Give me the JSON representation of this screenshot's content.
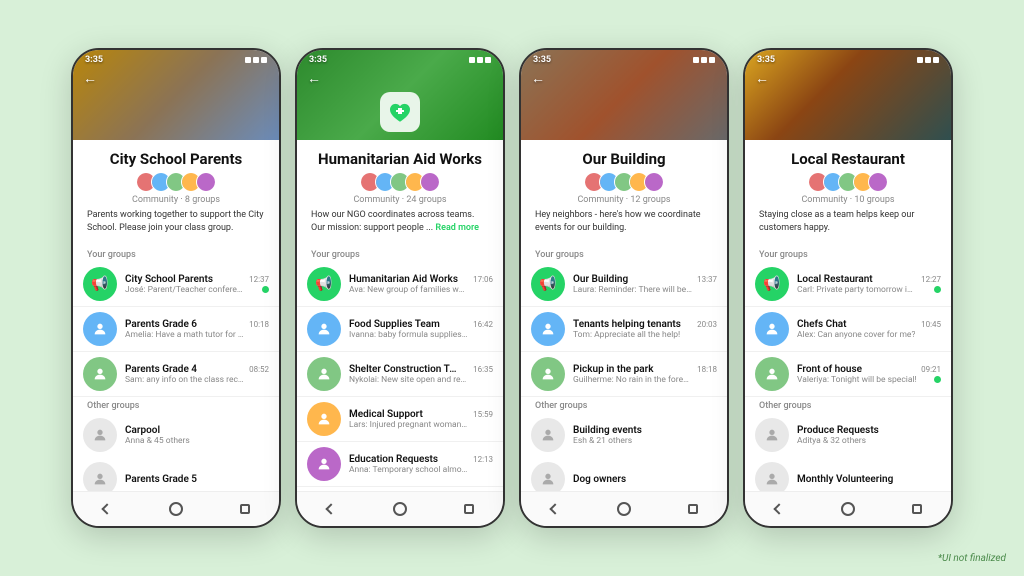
{
  "scene": {
    "background": "#d8f0d8",
    "disclaimer": "*UI not finalized"
  },
  "phones": [
    {
      "id": "city-school",
      "status_time": "3:35",
      "header_style": "school",
      "title": "City School Parents",
      "subtitle": "Community · 8 groups",
      "description": "Parents working together to support the City School. Please join your class group.",
      "your_groups_label": "Your groups",
      "your_groups": [
        {
          "name": "City School Parents",
          "time": "12:37",
          "msg": "José: Parent/Teacher conferences ...",
          "unread": true,
          "icon_type": "megaphone"
        },
        {
          "name": "Parents Grade 6",
          "time": "10:18",
          "msg": "Amelia: Have a math tutor for the upco...",
          "unread": false,
          "icon_type": "avatar"
        },
        {
          "name": "Parents Grade 4",
          "time": "08:52",
          "msg": "Sam: any info on the class recital?",
          "unread": false,
          "icon_type": "avatar"
        }
      ],
      "other_groups_label": "Other groups",
      "other_groups": [
        {
          "name": "Carpool",
          "sub": "Anna & 45 others"
        },
        {
          "name": "Parents Grade 5",
          "sub": ""
        }
      ]
    },
    {
      "id": "humanitarian-aid",
      "status_time": "3:35",
      "header_style": "aid",
      "title": "Humanitarian Aid Works",
      "subtitle": "Community · 24 groups",
      "description": "How our NGO coordinates across teams. Our mission: support people ...",
      "read_more": "Read more",
      "your_groups_label": "Your groups",
      "your_groups": [
        {
          "name": "Humanitarian Aid Works",
          "time": "17:06",
          "msg": "Ava: New group of families waiting ...",
          "unread": false,
          "icon_type": "megaphone"
        },
        {
          "name": "Food Supplies Team",
          "time": "16:42",
          "msg": "Ivanna: baby formula supplies running ...",
          "unread": false,
          "icon_type": "avatar"
        },
        {
          "name": "Shelter Construction Team",
          "time": "16:35",
          "msg": "Nykolai: New site open and ready for ...",
          "unread": false,
          "icon_type": "avatar"
        },
        {
          "name": "Medical Support",
          "time": "15:59",
          "msg": "Lars: Injured pregnant woman in need ...",
          "unread": false,
          "icon_type": "avatar"
        },
        {
          "name": "Education Requests",
          "time": "12:13",
          "msg": "Anna: Temporary school almost comp...",
          "unread": false,
          "icon_type": "avatar"
        }
      ],
      "other_groups_label": "",
      "other_groups": []
    },
    {
      "id": "our-building",
      "status_time": "3:35",
      "header_style": "building",
      "title": "Our Building",
      "subtitle": "Community · 12 groups",
      "description": "Hey neighbors - here's how we coordinate events for our building.",
      "your_groups_label": "Your groups",
      "your_groups": [
        {
          "name": "Our Building",
          "time": "13:37",
          "msg": "Laura: Reminder: There will be ...",
          "unread": false,
          "icon_type": "megaphone"
        },
        {
          "name": "Tenants helping tenants",
          "time": "20:03",
          "msg": "Tom: Appreciate all the help!",
          "unread": false,
          "icon_type": "avatar"
        },
        {
          "name": "Pickup in the park",
          "time": "18:18",
          "msg": "Guilherme: No rain in the forecast!",
          "unread": false,
          "icon_type": "avatar"
        }
      ],
      "other_groups_label": "Other groups",
      "other_groups": [
        {
          "name": "Building events",
          "sub": "Esh & 21 others"
        },
        {
          "name": "Dog owners",
          "sub": ""
        }
      ]
    },
    {
      "id": "local-restaurant",
      "status_time": "3:35",
      "header_style": "restaurant",
      "title": "Local Restaurant",
      "subtitle": "Community · 10 groups",
      "description": "Staying close as a team helps keep our customers happy.",
      "your_groups_label": "Your groups",
      "your_groups": [
        {
          "name": "Local Restaurant",
          "time": "12:27",
          "msg": "Carl: Private party tomorrow in the ...",
          "unread": true,
          "icon_type": "megaphone"
        },
        {
          "name": "Chefs Chat",
          "time": "10:45",
          "msg": "Alex: Can anyone cover for me?",
          "unread": false,
          "icon_type": "avatar"
        },
        {
          "name": "Front of house",
          "time": "09:21",
          "msg": "Valeriya: Tonight will be special!",
          "unread": true,
          "icon_type": "avatar"
        }
      ],
      "other_groups_label": "Other groups",
      "other_groups": [
        {
          "name": "Produce Requests",
          "sub": "Aditya & 32 others"
        },
        {
          "name": "Monthly Volunteering",
          "sub": ""
        }
      ]
    }
  ]
}
